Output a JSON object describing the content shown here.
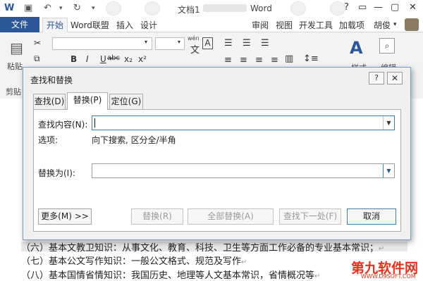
{
  "titlebar": {
    "title": "文档1",
    "app": "Word",
    "qat": {
      "save_icon": "save-icon",
      "undo_icon": "undo-icon",
      "redo_icon": "redo-icon",
      "customize_icon": "customize-icon"
    },
    "window_buttons": [
      "?",
      "▭",
      "—",
      "▢",
      "✕"
    ]
  },
  "tabs": {
    "file": "文件",
    "home": "开始",
    "items": [
      "Word联盟",
      "插入",
      "设计",
      "审阅",
      "视图",
      "开发工具",
      "加载项"
    ],
    "user": "胡俊"
  },
  "ribbon": {
    "paste_label": "粘贴",
    "clipboard_label": "剪贴",
    "style_label": "样式",
    "edit_label": "编辑",
    "font_buttons": [
      "B",
      "I",
      "U",
      "abc",
      "x₂",
      "x²"
    ],
    "wen_label": "wén",
    "char_box": "A"
  },
  "document": {
    "lines": [
      "（六）基本文教卫知识：从事文化、教育、科技、卫生等方面工作必备的专业基本常识；",
      "（七）基本公文写作知识：一般公文格式、规范及写作",
      "（八）基本国情省情知识：我国历史、地理等人文基本常识，省情概况等"
    ],
    "para_mark": "↵",
    "watermark_main": "第九软件网",
    "watermark_sub": "WWW.D9SOFT.COM"
  },
  "dialog": {
    "title": "查找和替换",
    "help": "?",
    "close": "✕",
    "tabs": [
      "查找(D)",
      "替换(P)",
      "定位(G)"
    ],
    "active_tab": 1,
    "find_label": "查找内容(N):",
    "find_value": "",
    "options_label": "选项:",
    "options_value": "向下搜索, 区分全/半角",
    "replace_label": "替换为(I):",
    "replace_value": "",
    "more_button": "更多(M) >>",
    "replace_button": "替换(R)",
    "replace_all_button": "全部替换(A)",
    "find_next_button": "查找下一处(F)",
    "cancel_button": "取消"
  }
}
